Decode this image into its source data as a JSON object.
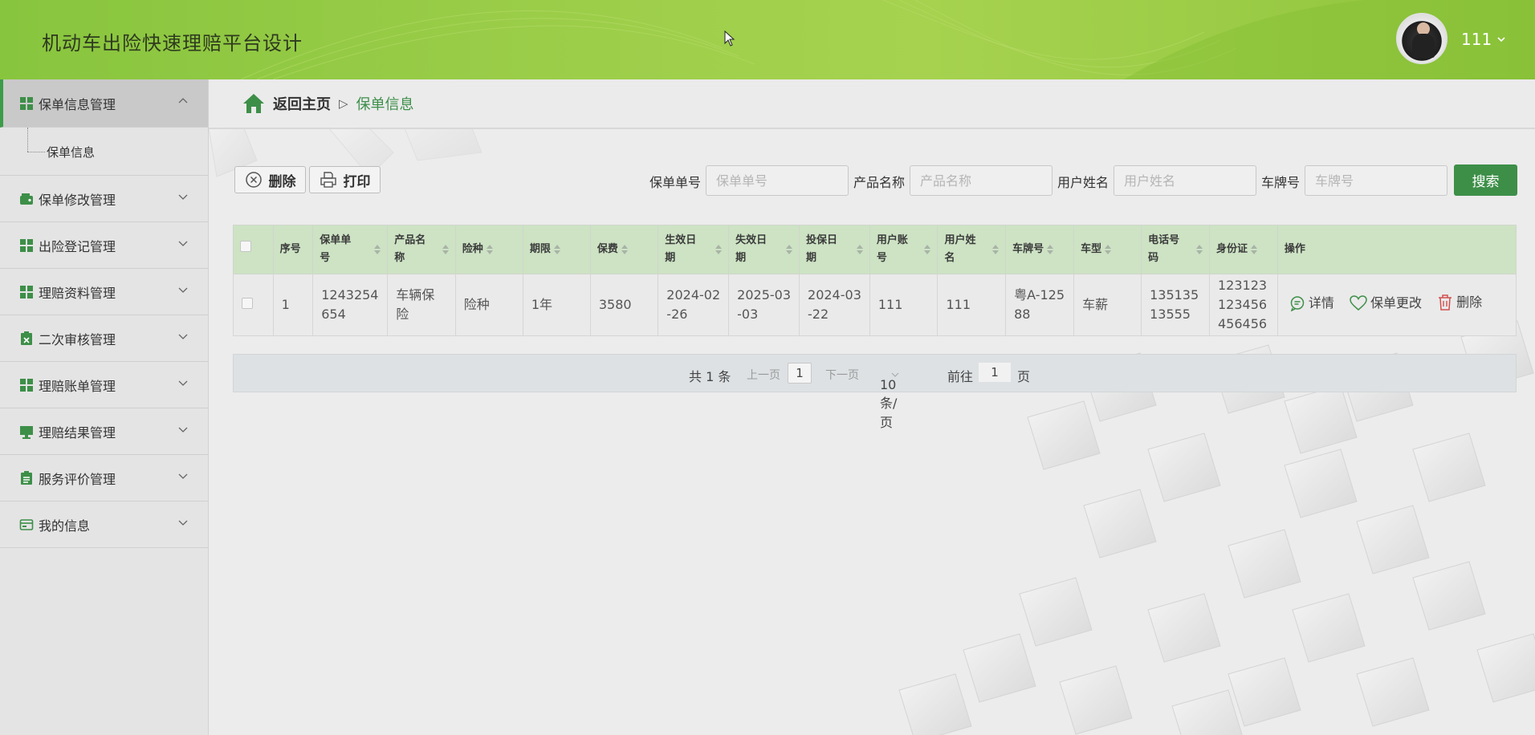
{
  "header": {
    "app_title": "机动车出险快速理赔平台设计",
    "username": "111",
    "accent_color": "#9ccc47"
  },
  "sidebar": {
    "items": [
      {
        "label": "保单信息管理",
        "icon": "grid-icon",
        "expanded": true
      },
      {
        "label": "保单修改管理",
        "icon": "wallet-icon"
      },
      {
        "label": "出险登记管理",
        "icon": "grid-icon"
      },
      {
        "label": "理赔资料管理",
        "icon": "grid-icon"
      },
      {
        "label": "二次审核管理",
        "icon": "clipboard-x-icon"
      },
      {
        "label": "理赔账单管理",
        "icon": "grid-icon"
      },
      {
        "label": "理赔结果管理",
        "icon": "monitor-icon"
      },
      {
        "label": "服务评价管理",
        "icon": "clipboard-icon"
      },
      {
        "label": "我的信息",
        "icon": "card-icon"
      }
    ],
    "sub_item": "保单信息"
  },
  "breadcrumb": {
    "home": "返回主页",
    "separator": "▷",
    "current": "保单信息"
  },
  "toolbar": {
    "delete_label": "删除",
    "print_label": "打印"
  },
  "search": {
    "fields": [
      {
        "label": "保单单号",
        "placeholder": "保单单号"
      },
      {
        "label": "产品名称",
        "placeholder": "产品名称"
      },
      {
        "label": "用户姓名",
        "placeholder": "用户姓名"
      },
      {
        "label": "车牌号",
        "placeholder": "车牌号"
      }
    ],
    "button": "搜索"
  },
  "table": {
    "headers": [
      "序号",
      "保单单号",
      "产品名称",
      "险种",
      "期限",
      "保费",
      "生效日期",
      "失效日期",
      "投保日期",
      "用户账号",
      "用户姓名",
      "车牌号",
      "车型",
      "电话号码",
      "身份证",
      "操作"
    ],
    "header_display": [
      "序号",
      "保单单\n号",
      "产品名\n称",
      "险种",
      "期限",
      "保费",
      "生效日\n期",
      "失效日\n期",
      "投保日\n期",
      "用户账\n号",
      "用户姓\n名",
      "车牌号",
      "车型",
      "电话号\n码",
      "身份证",
      "操作"
    ],
    "rows": [
      {
        "cells": [
          "1",
          "1243254654",
          "车辆保险",
          "险种",
          "1年",
          "3580",
          "2024-02-26",
          "2025-03-03",
          "2024-03-22",
          "111",
          "111",
          "粤A-12588",
          "车薪",
          "13513513555",
          "123123123456456456"
        ],
        "cells_display": [
          "1",
          "1243254\n654",
          "车辆保险",
          "险种",
          "1年",
          "3580",
          "2024-02\n-26",
          "2025-03\n-03",
          "2024-03\n-22",
          "111",
          "111",
          "粤A-125\n88",
          "车薪",
          "135135\n13555",
          "123123\n123456\n456456"
        ],
        "actions": {
          "detail": "详情",
          "modify": "保单更改",
          "delete": "删除"
        }
      }
    ]
  },
  "pagination": {
    "total": "共 1 条",
    "prev": "上一页",
    "page": "1",
    "next": "下一页",
    "page_size": "10条/页",
    "goto_label": "前往",
    "goto_value": "1",
    "goto_unit": "页"
  }
}
